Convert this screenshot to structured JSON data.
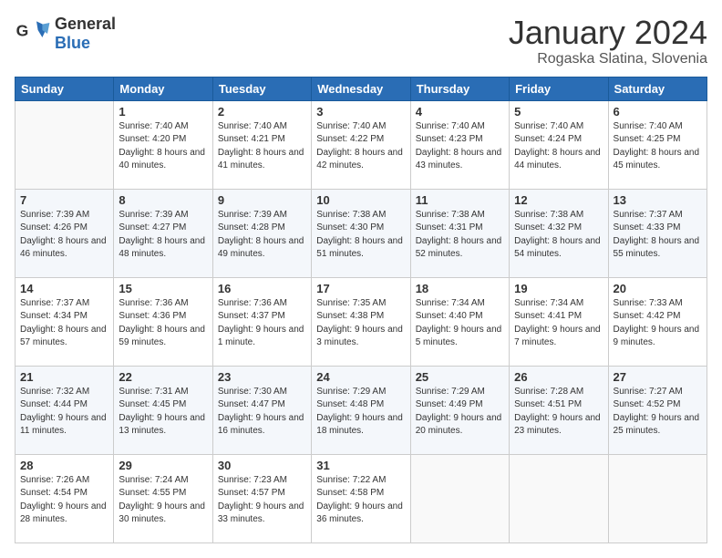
{
  "logo": {
    "general": "General",
    "blue": "Blue"
  },
  "title": "January 2024",
  "subtitle": "Rogaska Slatina, Slovenia",
  "weekdays": [
    "Sunday",
    "Monday",
    "Tuesday",
    "Wednesday",
    "Thursday",
    "Friday",
    "Saturday"
  ],
  "weeks": [
    [
      {
        "day": null,
        "sunrise": null,
        "sunset": null,
        "daylight": null
      },
      {
        "day": "1",
        "sunrise": "7:40 AM",
        "sunset": "4:20 PM",
        "daylight": "8 hours and 40 minutes."
      },
      {
        "day": "2",
        "sunrise": "7:40 AM",
        "sunset": "4:21 PM",
        "daylight": "8 hours and 41 minutes."
      },
      {
        "day": "3",
        "sunrise": "7:40 AM",
        "sunset": "4:22 PM",
        "daylight": "8 hours and 42 minutes."
      },
      {
        "day": "4",
        "sunrise": "7:40 AM",
        "sunset": "4:23 PM",
        "daylight": "8 hours and 43 minutes."
      },
      {
        "day": "5",
        "sunrise": "7:40 AM",
        "sunset": "4:24 PM",
        "daylight": "8 hours and 44 minutes."
      },
      {
        "day": "6",
        "sunrise": "7:40 AM",
        "sunset": "4:25 PM",
        "daylight": "8 hours and 45 minutes."
      }
    ],
    [
      {
        "day": "7",
        "sunrise": "7:39 AM",
        "sunset": "4:26 PM",
        "daylight": "8 hours and 46 minutes."
      },
      {
        "day": "8",
        "sunrise": "7:39 AM",
        "sunset": "4:27 PM",
        "daylight": "8 hours and 48 minutes."
      },
      {
        "day": "9",
        "sunrise": "7:39 AM",
        "sunset": "4:28 PM",
        "daylight": "8 hours and 49 minutes."
      },
      {
        "day": "10",
        "sunrise": "7:38 AM",
        "sunset": "4:30 PM",
        "daylight": "8 hours and 51 minutes."
      },
      {
        "day": "11",
        "sunrise": "7:38 AM",
        "sunset": "4:31 PM",
        "daylight": "8 hours and 52 minutes."
      },
      {
        "day": "12",
        "sunrise": "7:38 AM",
        "sunset": "4:32 PM",
        "daylight": "8 hours and 54 minutes."
      },
      {
        "day": "13",
        "sunrise": "7:37 AM",
        "sunset": "4:33 PM",
        "daylight": "8 hours and 55 minutes."
      }
    ],
    [
      {
        "day": "14",
        "sunrise": "7:37 AM",
        "sunset": "4:34 PM",
        "daylight": "8 hours and 57 minutes."
      },
      {
        "day": "15",
        "sunrise": "7:36 AM",
        "sunset": "4:36 PM",
        "daylight": "8 hours and 59 minutes."
      },
      {
        "day": "16",
        "sunrise": "7:36 AM",
        "sunset": "4:37 PM",
        "daylight": "9 hours and 1 minute."
      },
      {
        "day": "17",
        "sunrise": "7:35 AM",
        "sunset": "4:38 PM",
        "daylight": "9 hours and 3 minutes."
      },
      {
        "day": "18",
        "sunrise": "7:34 AM",
        "sunset": "4:40 PM",
        "daylight": "9 hours and 5 minutes."
      },
      {
        "day": "19",
        "sunrise": "7:34 AM",
        "sunset": "4:41 PM",
        "daylight": "9 hours and 7 minutes."
      },
      {
        "day": "20",
        "sunrise": "7:33 AM",
        "sunset": "4:42 PM",
        "daylight": "9 hours and 9 minutes."
      }
    ],
    [
      {
        "day": "21",
        "sunrise": "7:32 AM",
        "sunset": "4:44 PM",
        "daylight": "9 hours and 11 minutes."
      },
      {
        "day": "22",
        "sunrise": "7:31 AM",
        "sunset": "4:45 PM",
        "daylight": "9 hours and 13 minutes."
      },
      {
        "day": "23",
        "sunrise": "7:30 AM",
        "sunset": "4:47 PM",
        "daylight": "9 hours and 16 minutes."
      },
      {
        "day": "24",
        "sunrise": "7:29 AM",
        "sunset": "4:48 PM",
        "daylight": "9 hours and 18 minutes."
      },
      {
        "day": "25",
        "sunrise": "7:29 AM",
        "sunset": "4:49 PM",
        "daylight": "9 hours and 20 minutes."
      },
      {
        "day": "26",
        "sunrise": "7:28 AM",
        "sunset": "4:51 PM",
        "daylight": "9 hours and 23 minutes."
      },
      {
        "day": "27",
        "sunrise": "7:27 AM",
        "sunset": "4:52 PM",
        "daylight": "9 hours and 25 minutes."
      }
    ],
    [
      {
        "day": "28",
        "sunrise": "7:26 AM",
        "sunset": "4:54 PM",
        "daylight": "9 hours and 28 minutes."
      },
      {
        "day": "29",
        "sunrise": "7:24 AM",
        "sunset": "4:55 PM",
        "daylight": "9 hours and 30 minutes."
      },
      {
        "day": "30",
        "sunrise": "7:23 AM",
        "sunset": "4:57 PM",
        "daylight": "9 hours and 33 minutes."
      },
      {
        "day": "31",
        "sunrise": "7:22 AM",
        "sunset": "4:58 PM",
        "daylight": "9 hours and 36 minutes."
      },
      {
        "day": null,
        "sunrise": null,
        "sunset": null,
        "daylight": null
      },
      {
        "day": null,
        "sunrise": null,
        "sunset": null,
        "daylight": null
      },
      {
        "day": null,
        "sunrise": null,
        "sunset": null,
        "daylight": null
      }
    ]
  ]
}
